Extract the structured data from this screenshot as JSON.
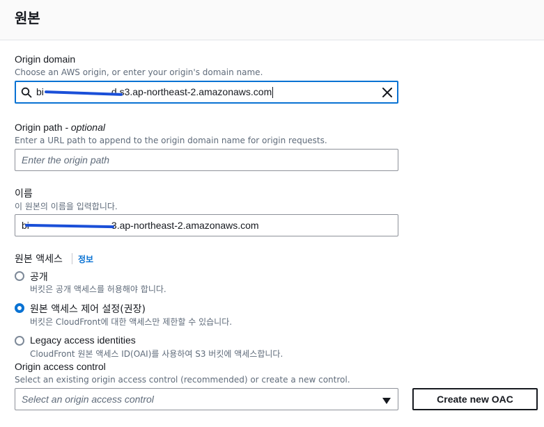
{
  "section": {
    "title": "원본"
  },
  "origin_domain": {
    "label": "Origin domain",
    "description": "Choose an AWS origin, or enter your origin's domain name.",
    "value_prefix": "bi",
    "value_suffix": "d.s3.ap-northeast-2.amazonaws.com",
    "search_icon": "search-icon",
    "clear_icon": "close-icon"
  },
  "origin_path": {
    "label": "Origin path",
    "label_optional": " - optional",
    "description": "Enter a URL path to append to the origin domain name for origin requests.",
    "placeholder": "Enter the origin path"
  },
  "name": {
    "label": "이름",
    "description": "이 원본의 이름을 입력합니다.",
    "value_prefix": "bi",
    "value_suffix": "3.ap-northeast-2.amazonaws.com"
  },
  "origin_access": {
    "label": "원본 액세스",
    "info_link": "정보",
    "options": [
      {
        "label": "공개",
        "description": "버킷은 공개 액세스를 허용해야 합니다.",
        "checked": false
      },
      {
        "label": "원본 액세스 제어 설정(권장)",
        "description": "버킷은 CloudFront에 대한 액세스만 제한할 수 있습니다.",
        "checked": true
      },
      {
        "label": "Legacy access identities",
        "description": "CloudFront 원본 액세스 ID(OAI)를 사용하여 S3 버킷에 액세스합니다.",
        "checked": false
      }
    ]
  },
  "origin_access_control": {
    "label": "Origin access control",
    "description": "Select an existing origin access control (recommended) or create a new control.",
    "placeholder": "Select an origin access control",
    "create_button": "Create new OAC",
    "dropdown_icon": "caret-down-icon"
  },
  "colors": {
    "accent": "#0972d3",
    "redaction": "#1a4fd8"
  }
}
